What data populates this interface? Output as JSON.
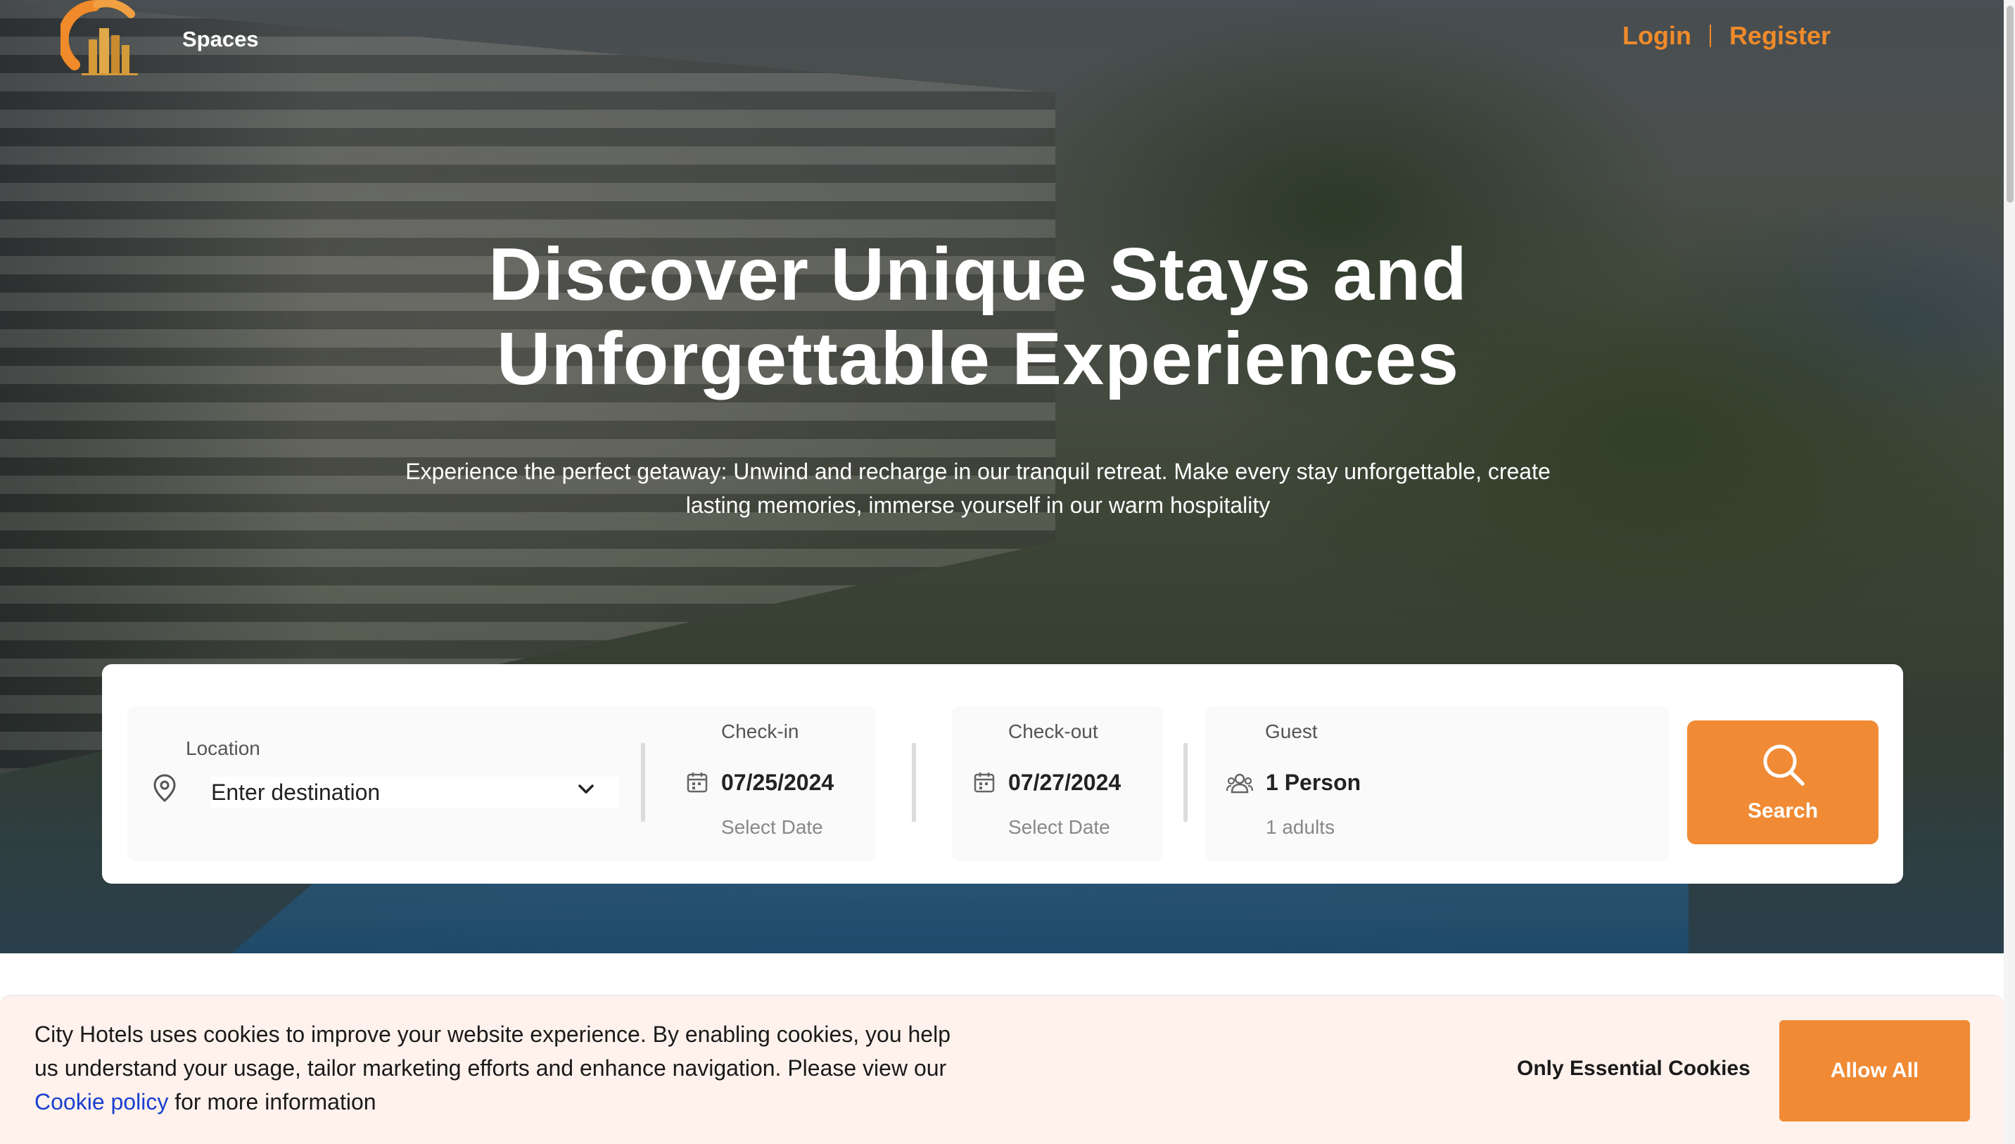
{
  "header": {
    "brand": "Spaces",
    "login_label": "Login",
    "register_label": "Register"
  },
  "hero": {
    "headline_line1": "Discover Unique Stays and",
    "headline_line2": "Unforgettable Experiences",
    "subline": "Experience the perfect getaway: Unwind and recharge in our tranquil retreat. Make every stay unforgettable, create lasting memories, immerse yourself in our warm hospitality"
  },
  "search": {
    "location_label": "Location",
    "location_placeholder": "Enter destination",
    "checkin_label": "Check-in",
    "checkin_value": "07/25/2024",
    "checkin_sub": "Select Date",
    "checkout_label": "Check-out",
    "checkout_value": "07/27/2024",
    "checkout_sub": "Select Date",
    "guest_label": "Guest",
    "guest_value": "1 Person",
    "guest_sub": "1 adults",
    "button_label": "Search"
  },
  "cookie": {
    "text_before": "City Hotels uses cookies to improve your website experience. By enabling cookies, you help us understand your usage, tailor marketing efforts and enhance navigation. Please view our ",
    "link_label": "Cookie policy",
    "text_after": " for more information",
    "essential_label": "Only Essential Cookies",
    "allow_label": "Allow All"
  },
  "icons": {
    "logo": "city-hotels-logo",
    "location": "map-pin-icon",
    "dropdown": "chevron-down-icon",
    "calendar": "calendar-icon",
    "guests": "users-icon",
    "search": "search-icon"
  },
  "colors": {
    "accent": "#f08a34",
    "link": "#1a3fd0",
    "cookie_bg": "#fff2ec"
  }
}
